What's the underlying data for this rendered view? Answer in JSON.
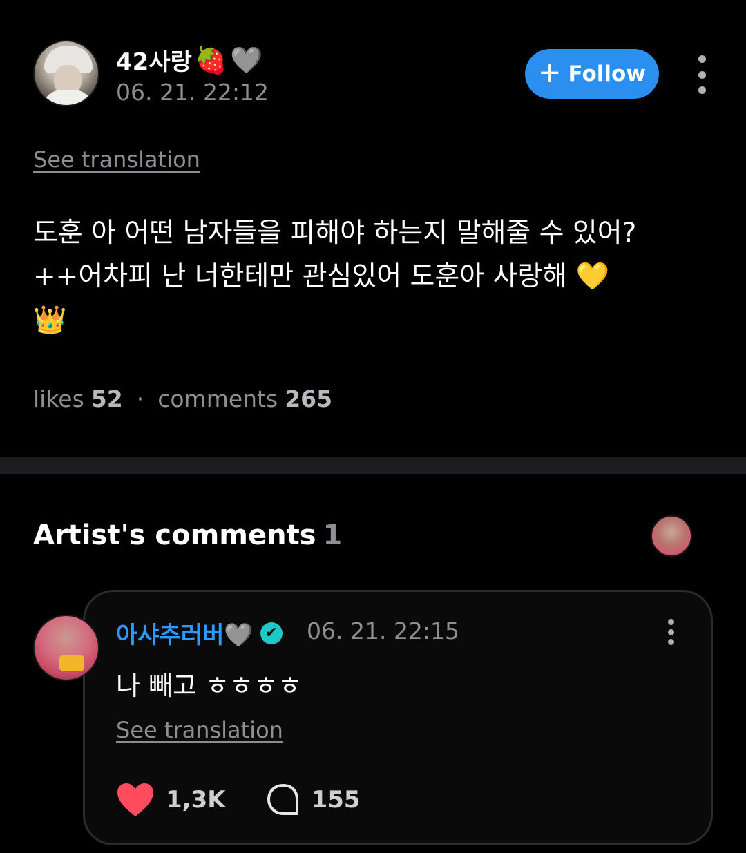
{
  "post": {
    "username": "42사랑",
    "username_emojis": [
      "🍓",
      "🩶"
    ],
    "timestamp": "06. 21. 22:12",
    "follow_label": "Follow",
    "see_translation": "See translation",
    "body_lines": [
      "도훈 아 어떤 남자들을 피해야 하는지 말해줄 수 있어?",
      "++어차피 난 너한테만 관심있어  도훈아 사랑해   💛",
      "👑"
    ],
    "likes_label": "likes",
    "likes_count": "52",
    "comments_label": "comments",
    "comments_count": "265"
  },
  "artist_comments": {
    "title": "Artist's comments",
    "count": "1"
  },
  "comment": {
    "author": "아샤추러버🩶",
    "verified_symbol": "✔",
    "timestamp": "06. 21. 22:15",
    "text": "나 빼고 ㅎㅎㅎㅎ",
    "see_translation": "See translation",
    "like_count": "1,3K",
    "reply_count": "155"
  },
  "colors": {
    "background": "#000000",
    "follow_button": "#2b8ff0",
    "artist_name": "#2b9bff",
    "verified": "#1ec8c8",
    "heart": "#ff4c5e",
    "muted_text": "#8e8e93"
  },
  "icons": {
    "plus": "plus-icon",
    "more": "more-vertical-icon",
    "verified": "verified-badge-icon",
    "heart": "heart-icon",
    "comment": "comment-bubble-icon"
  }
}
